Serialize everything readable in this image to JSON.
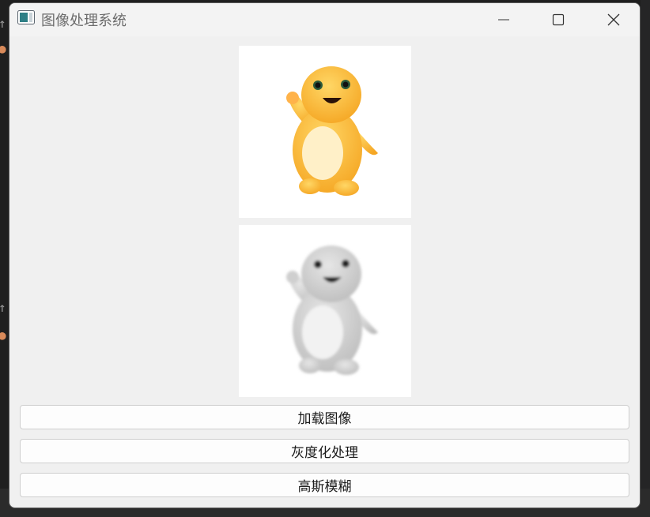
{
  "window": {
    "title": "图像处理系统",
    "icons": {
      "app": "app-window-icon",
      "minimize": "minimize-icon",
      "maximize": "maximize-icon",
      "close": "close-icon"
    }
  },
  "images": {
    "original": {
      "icon": "yellow-mascot-image"
    },
    "processed": {
      "icon": "grayscale-blurred-mascot-image"
    }
  },
  "buttons": {
    "load": "加载图像",
    "grayscale": "灰度化处理",
    "gaussian_blur": "高斯模糊"
  },
  "colors": {
    "window_bg": "#f0f0f0",
    "titlebar_bg": "#f3f3f3",
    "mascot_yellow": "#ffc23a",
    "mascot_belly": "#fff0c8"
  }
}
